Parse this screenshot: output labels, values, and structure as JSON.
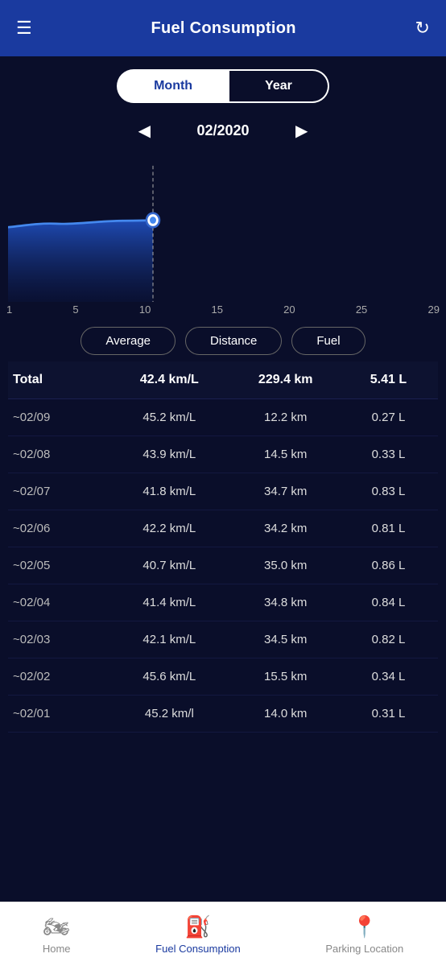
{
  "header": {
    "title": "Fuel Consumption",
    "hamburger_symbol": "☰",
    "refresh_symbol": "↻"
  },
  "period": {
    "month_label": "Month",
    "year_label": "Year",
    "active": "month"
  },
  "date_nav": {
    "prev_symbol": "◀",
    "next_symbol": "▶",
    "current": "02/2020"
  },
  "chart": {
    "x_labels": [
      "1",
      "5",
      "10",
      "15",
      "20",
      "25",
      "29"
    ]
  },
  "stats_buttons": {
    "average": "Average",
    "distance": "Distance",
    "fuel": "Fuel"
  },
  "table": {
    "columns": [
      "Total",
      "42.4 km/L",
      "229.4 km",
      "5.41 L"
    ],
    "rows": [
      {
        "date": "~02/09",
        "average": "45.2 km/L",
        "distance": "12.2 km",
        "fuel": "0.27 L"
      },
      {
        "date": "~02/08",
        "average": "43.9 km/L",
        "distance": "14.5 km",
        "fuel": "0.33 L"
      },
      {
        "date": "~02/07",
        "average": "41.8 km/L",
        "distance": "34.7 km",
        "fuel": "0.83 L"
      },
      {
        "date": "~02/06",
        "average": "42.2 km/L",
        "distance": "34.2 km",
        "fuel": "0.81 L"
      },
      {
        "date": "~02/05",
        "average": "40.7 km/L",
        "distance": "35.0 km",
        "fuel": "0.86 L"
      },
      {
        "date": "~02/04",
        "average": "41.4 km/L",
        "distance": "34.8 km",
        "fuel": "0.84 L"
      },
      {
        "date": "~02/03",
        "average": "42.1 km/L",
        "distance": "34.5 km",
        "fuel": "0.82 L"
      },
      {
        "date": "~02/02",
        "average": "45.6 km/L",
        "distance": "15.5 km",
        "fuel": "0.34 L"
      },
      {
        "date": "~02/01",
        "average": "45.2 km/l",
        "distance": "14.0 km",
        "fuel": "0.31 L"
      }
    ]
  },
  "bottom_nav": {
    "items": [
      {
        "id": "home",
        "label": "Home",
        "icon": "🏍",
        "active": false
      },
      {
        "id": "fuel",
        "label": "Fuel Consumption",
        "icon": "⛽",
        "active": true
      },
      {
        "id": "parking",
        "label": "Parking Location",
        "icon": "📍",
        "active": false
      }
    ]
  }
}
